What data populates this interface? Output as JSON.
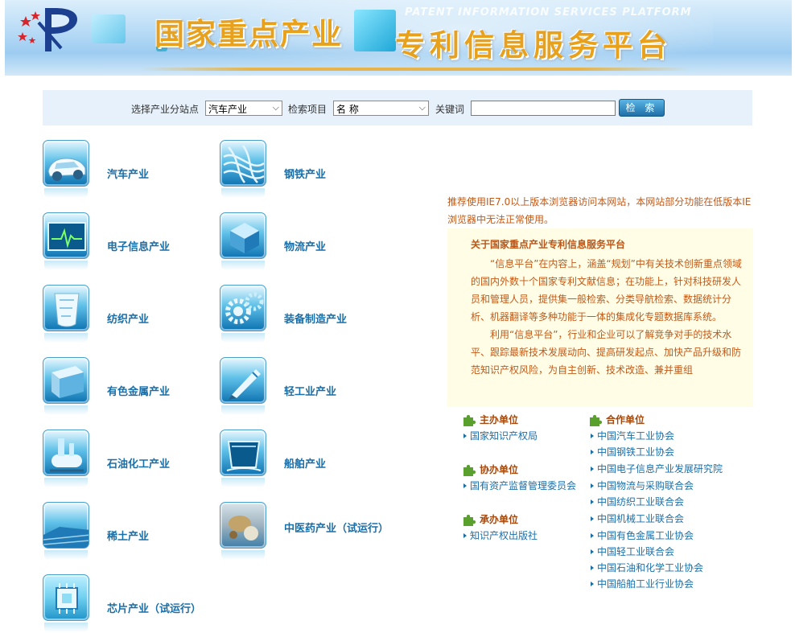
{
  "header": {
    "title_left": "国家重点产业",
    "title_en": "PATENT INFORMATION SERVICES PLATFORM",
    "title_right": "专利信息服务平台"
  },
  "search": {
    "site_label": "选择产业分站点",
    "site_value": "汽车产业",
    "item_label": "检索项目",
    "item_value": "名 称",
    "keyword_label": "关键词",
    "keyword_value": "",
    "button_label": "检 索"
  },
  "industries": [
    {
      "label": "汽车产业",
      "icon": "car-icon"
    },
    {
      "label": "钢铁产业",
      "icon": "steel-icon"
    },
    {
      "label": "电子信息产业",
      "icon": "electronics-icon"
    },
    {
      "label": "物流产业",
      "icon": "logistics-icon"
    },
    {
      "label": "纺织产业",
      "icon": "textile-icon"
    },
    {
      "label": "装备制造产业",
      "icon": "gears-icon"
    },
    {
      "label": "有色金属产业",
      "icon": "metal-icon"
    },
    {
      "label": "轻工业产业",
      "icon": "pen-icon"
    },
    {
      "label": "石油化工产业",
      "icon": "petrochemical-icon"
    },
    {
      "label": "船舶产业",
      "icon": "ship-icon"
    },
    {
      "label": "稀土产业",
      "icon": "rare-earth-icon"
    },
    {
      "label": "中医药产业（试运行）",
      "icon": "medicine-icon"
    },
    {
      "label": "芯片产业（试运行）",
      "icon": "chip-icon"
    }
  ],
  "notice": "推荐使用IE7.0以上版本浏览器访问本网站，本网站部分功能在低版本IE浏览器中无法正常使用。",
  "about": {
    "title": "关于国家重点产业专利信息服务平台",
    "paragraphs": [
      "“信息平台”在内容上，涵盖“规划”中有关技术创新重点领域的国内外数十个国家专利文献信息；在功能上，针对科技研发人员和管理人员，提供集一般检索、分类导航检索、数据统计分析、机器翻译等多种功能于一体的集成化专题数据库系统。",
      "利用“信息平台”，行业和企业可以了解竞争对手的技术水平、跟踪最新技术发展动向、提高研发起点、加快产品升级和防范知识产权风险，为自主创新、技术改造、兼并重组"
    ]
  },
  "sponsors": {
    "host_title": "主办单位",
    "host_items": [
      "国家知识产权局"
    ],
    "co_title": "协办单位",
    "co_items": [
      "国有资产监督管理委员会"
    ],
    "undertake_title": "承办单位",
    "undertake_items": [
      "知识产权出版社"
    ],
    "partner_title": "合作单位",
    "partner_items": [
      "中国汽车工业协会",
      "中国钢铁工业协会",
      "中国电子信息产业发展研究院",
      "中国物流与采购联合会",
      "中国纺织工业联合会",
      "中国机械工业联合会",
      "中国有色金属工业协会",
      "中国轻工业联合会",
      "中国石油和化学工业协会",
      "中国船舶工业行业协会"
    ]
  },
  "colors": {
    "accent": "#1b6fa8",
    "title_gold": "#e8a11c",
    "notice_orange": "#c05a1a",
    "about_bg": "#fffde6"
  }
}
